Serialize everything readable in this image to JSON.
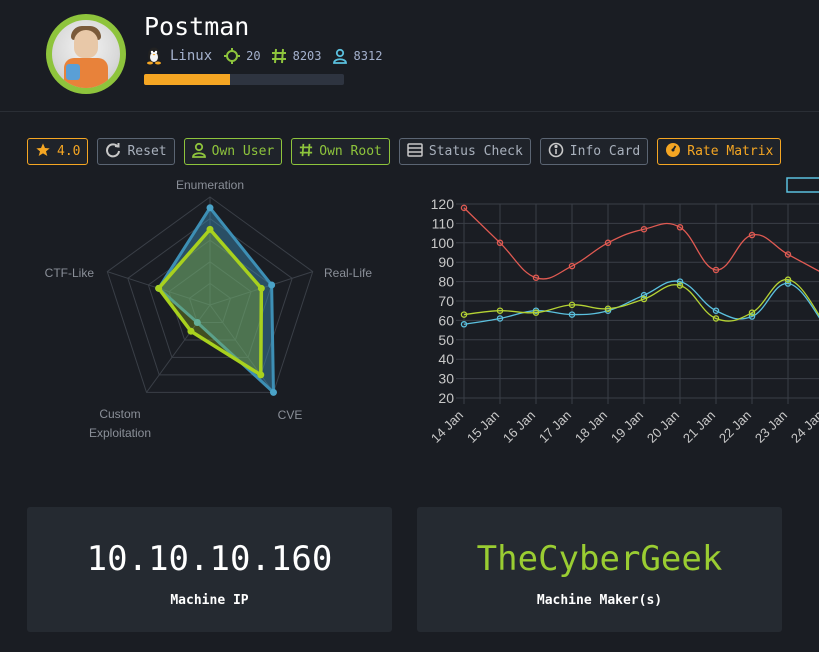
{
  "machine": {
    "name": "Postman",
    "os": "Linux",
    "points": "20",
    "root_owns": "8203",
    "user_owns": "8312",
    "progress_fraction": 0.43
  },
  "toolbar": {
    "rating": "4.0",
    "reset": "Reset",
    "own_user": "Own User",
    "own_root": "Own Root",
    "status_check": "Status Check",
    "info_card": "Info Card",
    "rate_matrix": "Rate Matrix"
  },
  "colors": {
    "accent_green": "#8ec43c",
    "accent_gold": "#f5a623",
    "series_red": "#e05a52",
    "series_blue": "#5bc0de",
    "series_green": "#b5d334"
  },
  "chart_data": [
    {
      "type": "radar",
      "axes": [
        "Enumeration",
        "Real-Life",
        "CVE",
        "Custom Exploitation",
        "CTF-Like"
      ],
      "series": [
        {
          "values": [
            9,
            6,
            10,
            2,
            5
          ]
        },
        {
          "values": [
            7,
            5,
            8,
            3,
            5
          ]
        }
      ],
      "range": [
        0,
        10
      ]
    },
    {
      "type": "line",
      "x": [
        "14 Jan",
        "15 Jan",
        "16 Jan",
        "17 Jan",
        "18 Jan",
        "19 Jan",
        "20 Jan",
        "21 Jan",
        "22 Jan",
        "23 Jan",
        "24 Jan"
      ],
      "yticks": [
        "120",
        "110",
        "100",
        "90",
        "80",
        "70",
        "60",
        "50",
        "40",
        "30",
        "20"
      ],
      "ylim": [
        20,
        120
      ],
      "series": [
        {
          "color": "#e05a52",
          "values": [
            118,
            100,
            82,
            88,
            100,
            107,
            108,
            86,
            104,
            94,
            84
          ]
        },
        {
          "color": "#5bc0de",
          "values": [
            58,
            61,
            65,
            63,
            65,
            73,
            80,
            65,
            62,
            79,
            58
          ]
        },
        {
          "color": "#b5d334",
          "values": [
            63,
            65,
            64,
            68,
            66,
            71,
            78,
            61,
            64,
            81,
            59
          ]
        }
      ]
    }
  ],
  "cards": {
    "ip_value": "10.10.10.160",
    "ip_label": "Machine IP",
    "maker_value": "TheCyberGeek",
    "maker_label": "Machine Maker(s)"
  }
}
